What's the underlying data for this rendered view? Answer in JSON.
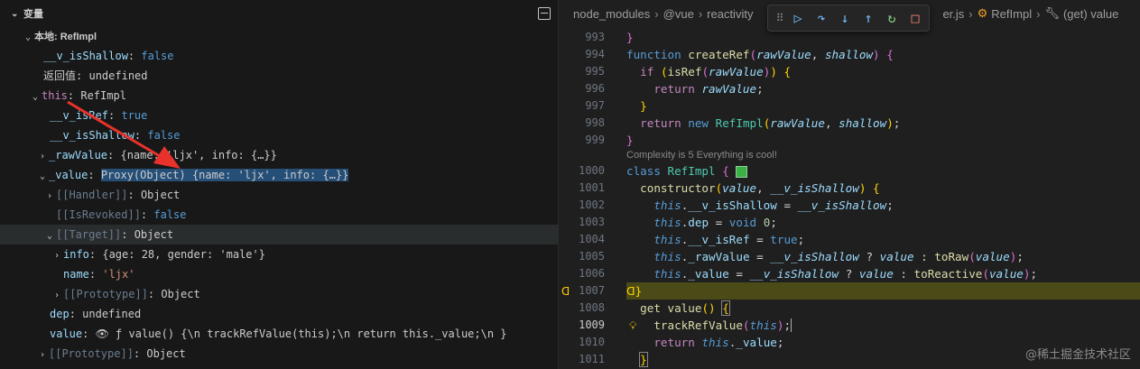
{
  "variables_panel": {
    "header_title": "变量",
    "rows": [
      {
        "key": "local_scope",
        "label": "本地: RefImpl"
      },
      {
        "key": "v_isShallow",
        "name": "__v_isShallow",
        "value": "false"
      },
      {
        "key": "return_value",
        "name": "返回值",
        "value": "undefined"
      },
      {
        "key": "this",
        "name": "this",
        "value": "RefImpl"
      },
      {
        "key": "v_isRef",
        "name": "__v_isRef",
        "value": "true"
      },
      {
        "key": "v_isShallow2",
        "name": "__v_isShallow",
        "value": "false"
      },
      {
        "key": "rawValue",
        "name": "_rawValue",
        "value": "{name: 'ljx', info: {…}}"
      },
      {
        "key": "value",
        "name": "_value",
        "value": "Proxy(Object) {name: 'ljx', info: {…}}"
      },
      {
        "key": "handler",
        "name": "[[Handler]]",
        "value": "Object"
      },
      {
        "key": "isrevoked",
        "name": "[[IsRevoked]]",
        "value": "false"
      },
      {
        "key": "target",
        "name": "[[Target]]",
        "value": "Object"
      },
      {
        "key": "info",
        "name": "info",
        "value": "{age: 28, gender: 'male'}"
      },
      {
        "key": "name",
        "name": "name",
        "value": "'ljx'"
      },
      {
        "key": "prototype_inner",
        "name": "[[Prototype]]",
        "value": "Object"
      },
      {
        "key": "dep",
        "name": "dep",
        "value": "undefined"
      },
      {
        "key": "value_getter",
        "name": "value",
        "value": "ƒ value() {\\n    trackRefValue(this);\\n    return this._value;\\n  }"
      },
      {
        "key": "prototype_outer",
        "name": "[[Prototype]]",
        "value": "Object"
      }
    ]
  },
  "breadcrumb": [
    "node_modules",
    "@vue",
    "reactivity",
    "er.js",
    "RefImpl",
    "(get) value"
  ],
  "debug_toolbar": [
    "drag-handle",
    "continue",
    "step-over",
    "step-into",
    "step-out",
    "restart",
    "stop"
  ],
  "editor": {
    "inline_hint": "Complexity is 5 Everything is cool!",
    "lines": [
      {
        "n": "993"
      },
      {
        "n": "994"
      },
      {
        "n": "995"
      },
      {
        "n": "996"
      },
      {
        "n": "997"
      },
      {
        "n": "998"
      },
      {
        "n": "999"
      },
      {
        "n": "1000"
      },
      {
        "n": "1001"
      },
      {
        "n": "1002"
      },
      {
        "n": "1003"
      },
      {
        "n": "1004"
      },
      {
        "n": "1005"
      },
      {
        "n": "1006"
      },
      {
        "n": "1007"
      },
      {
        "n": "1008"
      },
      {
        "n": "1009"
      },
      {
        "n": "1010"
      },
      {
        "n": "1011"
      }
    ]
  },
  "watermark": "@稀土掘金技术社区",
  "colors": {
    "accent": "#75beff",
    "highlight_line": "#4b4b18",
    "arrow": "#e8322b"
  }
}
